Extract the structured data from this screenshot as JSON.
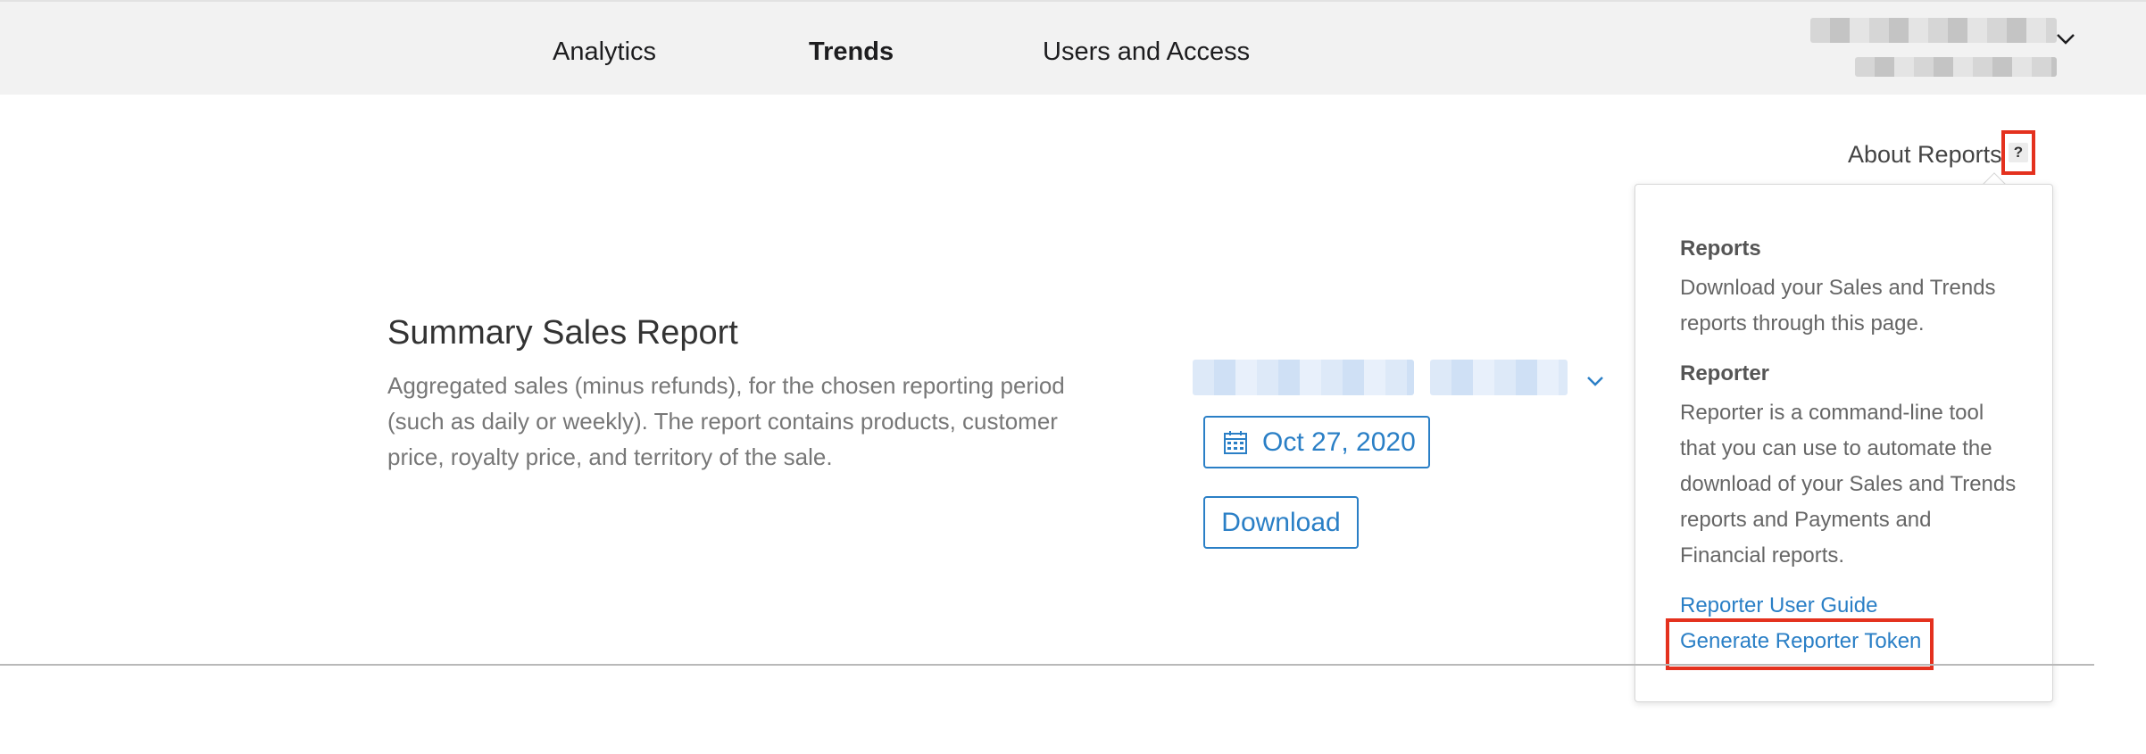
{
  "nav": {
    "items": [
      {
        "label": "Analytics"
      },
      {
        "label": "Trends"
      },
      {
        "label": "Users and Access"
      }
    ]
  },
  "about": {
    "label": "About Reports",
    "help": "?"
  },
  "popover": {
    "reports_heading": "Reports",
    "reports_text": "Download your Sales and Trends reports through this page.",
    "reporter_heading": "Reporter",
    "reporter_text": "Reporter is a command-line tool that you can use to automate the download of your Sales and Trends reports and Payments and Financial reports.",
    "link_guide": "Reporter User Guide",
    "link_token": "Generate Reporter Token"
  },
  "report": {
    "title": "Summary Sales Report",
    "description": "Aggregated sales (minus refunds), for the chosen reporting period (such as daily or weekly). The report contains products, customer price, royalty price, and territory of the sale.",
    "date": "Oct 27, 2020",
    "download_label": "Download"
  },
  "icons": {
    "account_chevron": "chevron-down-icon",
    "select_chevron": "chevron-down-icon",
    "calendar": "calendar-icon"
  },
  "colors": {
    "accent": "#2a7fc6",
    "highlight": "#e4311e"
  }
}
